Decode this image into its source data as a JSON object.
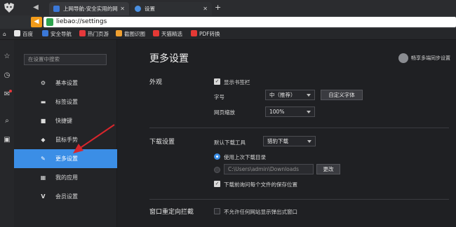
{
  "tabs": [
    {
      "title": "上网导航-安全实用的网",
      "favicon_color": "#3b78d8"
    },
    {
      "title": "设置",
      "favicon_color": "#4a90e2"
    }
  ],
  "address": {
    "url": "liebao://settings"
  },
  "bookmarks": [
    {
      "label": "百度",
      "color": "#ffffff"
    },
    {
      "label": "安全导航",
      "color": "#3b78d8"
    },
    {
      "label": "热门页游",
      "color": "#e5383b"
    },
    {
      "label": "截图识图",
      "color": "#f0a030"
    },
    {
      "label": "天猫精选",
      "color": "#e53935"
    },
    {
      "label": "PDF转换",
      "color": "#e53935"
    }
  ],
  "sidebar": {
    "search_placeholder": "在设置中搜索",
    "items": [
      {
        "label": "基本设置",
        "icon": "gear-icon",
        "glyph": "⚙"
      },
      {
        "label": "标签设置",
        "icon": "tab-icon",
        "glyph": "▬"
      },
      {
        "label": "快捷键",
        "icon": "keyboard-icon",
        "glyph": "■"
      },
      {
        "label": "鼠标手势",
        "icon": "mouse-icon",
        "glyph": "◆"
      },
      {
        "label": "更多设置",
        "icon": "wrench-icon",
        "glyph": "✎"
      },
      {
        "label": "我的应用",
        "icon": "apps-icon",
        "glyph": "▦"
      },
      {
        "label": "会员设置",
        "icon": "vip-icon",
        "glyph": "V"
      }
    ],
    "active_index": 4
  },
  "main": {
    "title": "更多设置",
    "sync_label": "畅享多端同步设置",
    "appearance": {
      "section": "外观",
      "show_bookmarks": "显示书签栏",
      "font_label": "字号",
      "font_value": "中（推荐）",
      "custom_font": "自定义字体",
      "zoom_label": "网页缩放",
      "zoom_value": "100%"
    },
    "download": {
      "section": "下载设置",
      "tool_label": "默认下载工具",
      "tool_value": "猎豹下载",
      "use_last_dir": "使用上次下载目录",
      "path_value": "C:\\Users\\admin\\Downloads",
      "change_btn": "更改",
      "ask_each": "下载前询问每个文件的保存位置"
    },
    "redirect": {
      "section": "窗口重定向拦截",
      "disallow_popup": "不允许任何网站显示弹出式窗口"
    }
  }
}
